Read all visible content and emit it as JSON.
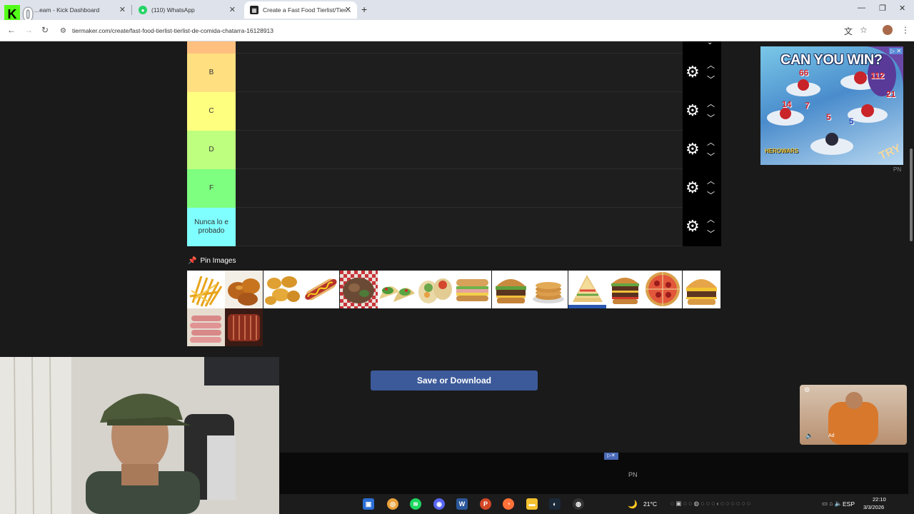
{
  "browser": {
    "tabs": [
      {
        "title": "...eam - Kick Dashboard",
        "active": false
      },
      {
        "title": "(110) WhatsApp",
        "active": false
      },
      {
        "title": "Create a Fast Food Tierlist/Tier...",
        "active": true
      }
    ],
    "url": "tiermaker.com/create/fast-food-tierlist-tierlist-de-comida-chatarra-16128913"
  },
  "overlay": {
    "stream_count": "0"
  },
  "tiers": [
    {
      "label": "B",
      "color": "#ffdf80"
    },
    {
      "label": "C",
      "color": "#ffff7f"
    },
    {
      "label": "D",
      "color": "#bfff7f"
    },
    {
      "label": "F",
      "color": "#7fff7f"
    },
    {
      "label": "Nunca lo e probado",
      "color": "#7fffff"
    }
  ],
  "pin_images_label": "Pin Images",
  "food_icons": [
    "fries-icon",
    "fried-chicken-icon",
    "nuggets-icon",
    "hotdog-icon",
    "kebab-icon",
    "tacos-icon",
    "wraps-icon",
    "sub-sandwich-icon",
    "burger-icon",
    "pancakes-icon",
    "club-sandwich-icon",
    "double-burger-icon",
    "pizza-icon",
    "cheeseburger-icon",
    "sausages-icon",
    "ribs-icon"
  ],
  "save_button_label": "Save or Download",
  "ad": {
    "title": "CAN YOU WIN?",
    "numbers": [
      "66",
      "112",
      "21",
      "14",
      "7",
      "5",
      "5"
    ],
    "brand": "HEROWARS",
    "cta": "TRY",
    "badge": "PN"
  },
  "ad2": {
    "label": "Ad"
  },
  "footer": {
    "pn": "PN"
  },
  "taskbar": {
    "weather": "21°C",
    "lang": "ESP",
    "time": "22:10",
    "date": "3/3/2026"
  }
}
